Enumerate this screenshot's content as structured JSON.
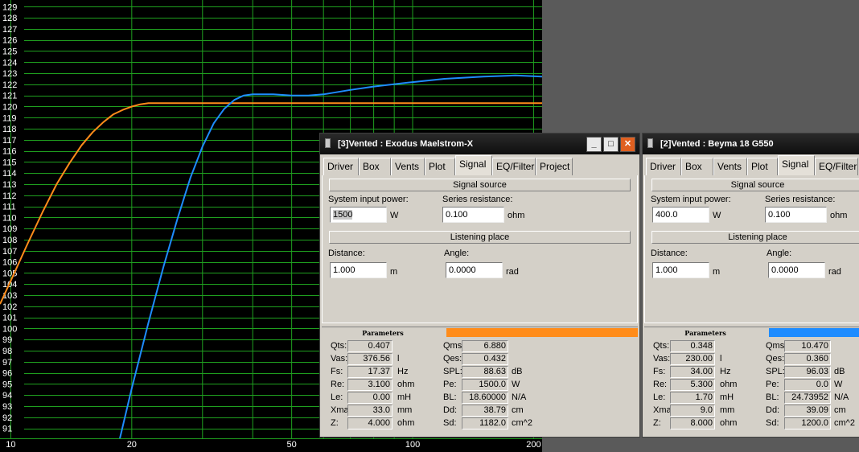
{
  "chart_data": {
    "type": "line",
    "y_ticks": [
      "129",
      "128",
      "127",
      "126",
      "125",
      "124",
      "123",
      "122",
      "121",
      "120",
      "119",
      "118",
      "117",
      "116",
      "115",
      "114",
      "113",
      "112",
      "111",
      "110",
      "109",
      "108",
      "107",
      "106",
      "105",
      "104",
      "103",
      "102",
      "101",
      "100",
      "99",
      "98",
      "97",
      "96",
      "95",
      "94",
      "93",
      "92",
      "91"
    ],
    "x_ticks": [
      "10",
      "20",
      "50",
      "100",
      "200"
    ],
    "x_scale": "log",
    "xlim": [
      9.4,
      210
    ],
    "ylim": [
      90.1,
      129.6
    ],
    "grid": true,
    "series": [
      {
        "color": "#ff8c1a",
        "x": [
          9.4,
          10,
          11,
          12,
          13,
          14,
          15,
          16,
          17,
          18,
          19,
          20,
          21,
          22,
          23,
          24,
          26,
          30,
          40,
          60,
          100,
          150,
          210
        ],
        "y": [
          102.2,
          104.3,
          107.6,
          110.5,
          113.0,
          114.9,
          116.5,
          117.7,
          118.6,
          119.3,
          119.7,
          120.0,
          120.2,
          120.3,
          120.3,
          120.3,
          120.3,
          120.3,
          120.3,
          120.3,
          120.3,
          120.3,
          120.3
        ]
      },
      {
        "color": "#1e8cff",
        "x": [
          18.6,
          20,
          22,
          24,
          26,
          28,
          30,
          32,
          34,
          36,
          38,
          40,
          42,
          45,
          50,
          55,
          60,
          70,
          80,
          100,
          120,
          150,
          180,
          210
        ],
        "y": [
          89.8,
          94.6,
          100.5,
          105.6,
          109.9,
          113.6,
          116.4,
          118.5,
          119.8,
          120.6,
          121.0,
          121.1,
          121.1,
          121.1,
          121.0,
          121.0,
          121.1,
          121.5,
          121.8,
          122.2,
          122.5,
          122.7,
          122.8,
          122.7
        ]
      }
    ]
  },
  "colors": {
    "orange": "#ff8c1a",
    "blue": "#1e8cff"
  },
  "win1": {
    "title": "[3]Vented : Exodus Maelstrom-X",
    "tabs": [
      "Driver",
      "Box",
      "Vents",
      "Plot",
      "Signal",
      "EQ/Filter",
      "Project"
    ],
    "signal_source": "Signal source",
    "input_power_label": "System input power:",
    "input_power_value": "1500",
    "input_power_unit": "W",
    "series_res_label": "Series resistance:",
    "series_res_value": "0.100",
    "series_res_unit": "ohm",
    "listening_place": "Listening place",
    "distance_label": "Distance:",
    "distance_value": "1.000",
    "distance_unit": "m",
    "angle_label": "Angle:",
    "angle_value": "0.0000",
    "angle_unit": "rad",
    "params_header": "Parameters",
    "params_left": [
      {
        "label": "Qts:",
        "value": "0.407",
        "unit": ""
      },
      {
        "label": "Vas:",
        "value": "376.56",
        "unit": "l"
      },
      {
        "label": "Fs:",
        "value": "17.37",
        "unit": "Hz"
      },
      {
        "label": "Re:",
        "value": "3.100",
        "unit": "ohm"
      },
      {
        "label": "Le:",
        "value": "0.00",
        "unit": "mH"
      },
      {
        "label": "Xmax:",
        "value": "33.0",
        "unit": "mm"
      },
      {
        "label": "Z:",
        "value": "4.000",
        "unit": "ohm"
      }
    ],
    "params_right": [
      {
        "label": "Qms:",
        "value": "6.880",
        "unit": ""
      },
      {
        "label": "Qes:",
        "value": "0.432",
        "unit": ""
      },
      {
        "label": "SPL:",
        "value": "88.63",
        "unit": "dB"
      },
      {
        "label": "Pe:",
        "value": "1500.0",
        "unit": "W"
      },
      {
        "label": "BL:",
        "value": "18.60000",
        "unit": "N/A"
      },
      {
        "label": "Dd:",
        "value": "38.79",
        "unit": "cm"
      },
      {
        "label": "Sd:",
        "value": "1182.0",
        "unit": "cm^2"
      }
    ]
  },
  "win2": {
    "title": "[2]Vented : Beyma 18 G550",
    "tabs": [
      "Driver",
      "Box",
      "Vents",
      "Plot",
      "Signal",
      "EQ/Filter"
    ],
    "signal_source": "Signal source",
    "input_power_label": "System input power:",
    "input_power_value": "400.0",
    "input_power_unit": "W",
    "series_res_label": "Series resistance:",
    "series_res_value": "0.100",
    "series_res_unit": "ohm",
    "listening_place": "Listening place",
    "distance_label": "Distance:",
    "distance_value": "1.000",
    "distance_unit": "m",
    "angle_label": "Angle:",
    "angle_value": "0.0000",
    "angle_unit": "rad",
    "params_header": "Parameters",
    "params_left": [
      {
        "label": "Qts:",
        "value": "0.348",
        "unit": ""
      },
      {
        "label": "Vas:",
        "value": "230.00",
        "unit": "l"
      },
      {
        "label": "Fs:",
        "value": "34.00",
        "unit": "Hz"
      },
      {
        "label": "Re:",
        "value": "5.300",
        "unit": "ohm"
      },
      {
        "label": "Le:",
        "value": "1.70",
        "unit": "mH"
      },
      {
        "label": "Xmax:",
        "value": "9.0",
        "unit": "mm"
      },
      {
        "label": "Z:",
        "value": "8.000",
        "unit": "ohm"
      }
    ],
    "params_right": [
      {
        "label": "Qms:",
        "value": "10.470",
        "unit": ""
      },
      {
        "label": "Qes:",
        "value": "0.360",
        "unit": ""
      },
      {
        "label": "SPL:",
        "value": "96.03",
        "unit": "dB"
      },
      {
        "label": "Pe:",
        "value": "0.0",
        "unit": "W"
      },
      {
        "label": "BL:",
        "value": "24.73952",
        "unit": "N/A"
      },
      {
        "label": "Dd:",
        "value": "39.09",
        "unit": "cm"
      },
      {
        "label": "Sd:",
        "value": "1200.0",
        "unit": "cm^2"
      }
    ]
  }
}
